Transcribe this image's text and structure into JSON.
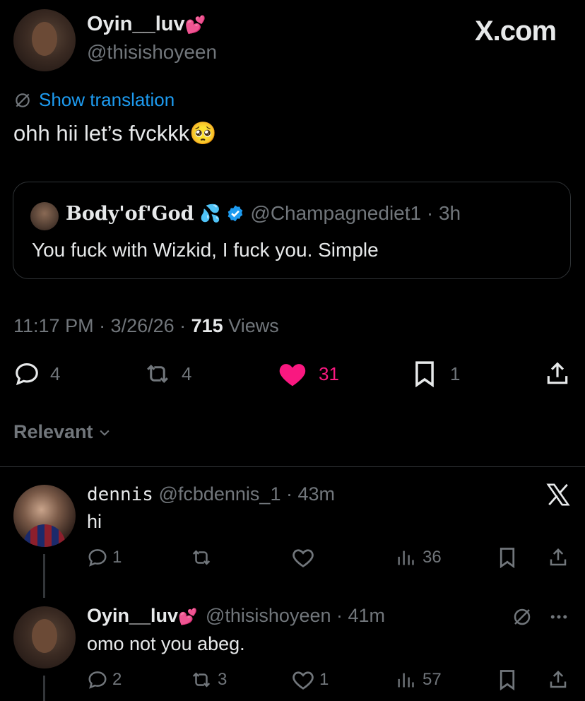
{
  "main_tweet": {
    "display_name": "Oyin__luv",
    "name_emoji": "💕",
    "handle": "@thisishoyeen",
    "show_translation": "Show translation",
    "text": "ohh hii let’s fvckkk",
    "text_emoji": "🥺",
    "timestamp": "11:17 PM · 3/26/26 · ",
    "views_count": "715",
    "views_label": " Views",
    "stats": {
      "replies": "4",
      "reposts": "4",
      "likes": "31",
      "bookmarks": "1"
    }
  },
  "brand": {
    "watermark": "X.com"
  },
  "quoted_tweet": {
    "display_name": "Body'of'God",
    "name_emoji": "💦",
    "handle_time": "@Champagnediet1 · 3h",
    "text": "You fuck with Wizkid, I fuck you. Simple"
  },
  "sort": {
    "label": "Relevant"
  },
  "replies": [
    {
      "display_name": "dennis",
      "handle_time": "@fcbdennis_1 · 43m",
      "text": "hi",
      "stats": {
        "replies": "1",
        "reposts": "",
        "likes": "",
        "views": "36"
      }
    },
    {
      "display_name": "Oyin__luv",
      "name_emoji": "💕",
      "handle_time": "@thisishoyeen · 41m",
      "text": "omo not you abeg.",
      "stats": {
        "replies": "2",
        "reposts": "3",
        "likes": "1",
        "views": "57"
      }
    }
  ],
  "colors": {
    "like_active": "#f91880",
    "link": "#1d9bf0",
    "muted": "#71767b",
    "background": "#000000"
  }
}
